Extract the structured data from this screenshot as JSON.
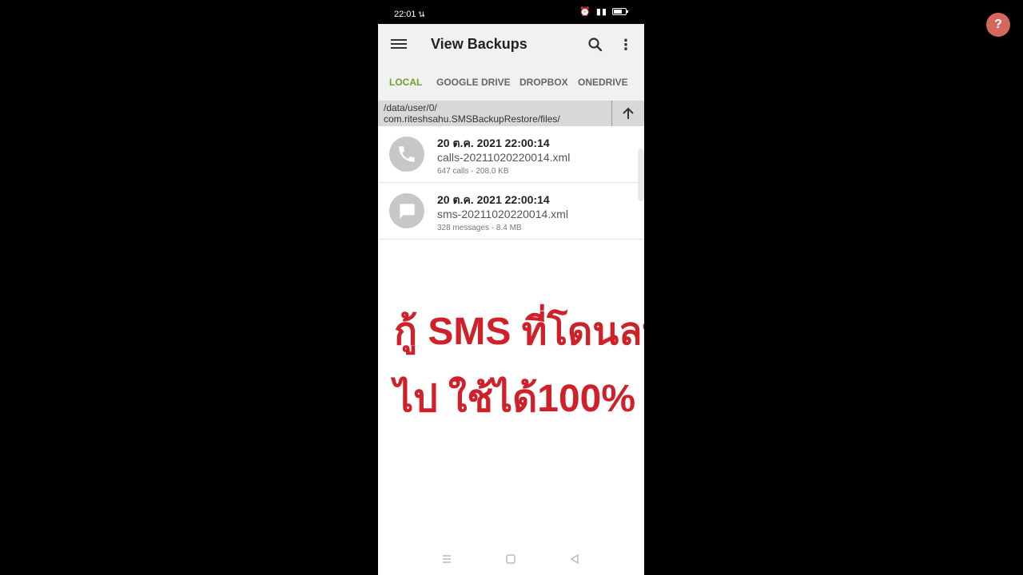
{
  "status": {
    "time": "22:01",
    "time_suffix": "น",
    "battery_level": 0.7
  },
  "appbar": {
    "title": "View Backups",
    "more_symbol": "⋮"
  },
  "tabs": [
    {
      "label": "LOCAL",
      "active": true
    },
    {
      "label": "GOOGLE DRIVE",
      "active": false
    },
    {
      "label": "DROPBOX",
      "active": false
    },
    {
      "label": "ONEDRIVE",
      "active": false
    }
  ],
  "path": {
    "line1": "/data/user/0/",
    "line2": "com.riteshsahu.SMSBackupRestore/files/"
  },
  "backups": [
    {
      "date": "20 ต.ค. 2021 22:00:14",
      "filename": "calls-20211020220014.xml",
      "meta": "647 calls - 208.0 KB",
      "icon": "phone-icon"
    },
    {
      "date": "20 ต.ค. 2021 22:00:14",
      "filename": "sms-20211020220014.xml",
      "meta": "328 messages - 8.4 MB",
      "icon": "message-icon"
    }
  ],
  "overlay": {
    "line1": "กู้ SMS  ที่โดนลบ",
    "line2": "ไป ใช้ได้100%",
    "color": "#d0202a"
  },
  "help": {
    "label": "?"
  }
}
